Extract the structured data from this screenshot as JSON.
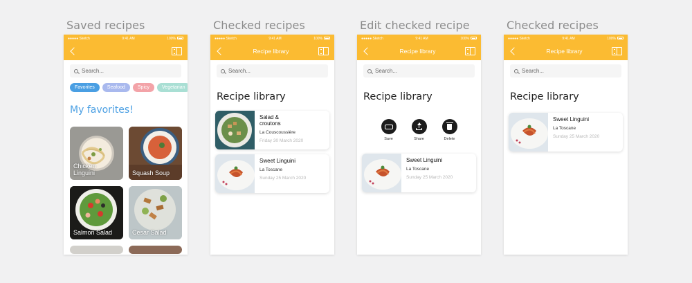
{
  "screens": [
    {
      "title": "Saved recipes",
      "search_placeholder": "Search...",
      "tags": [
        {
          "label": "Favorites",
          "color": "#4a9fe3"
        },
        {
          "label": "Seafood",
          "color": "#a9b9ee"
        },
        {
          "label": "Spicy",
          "color": "#f3a3a8"
        },
        {
          "label": "Vegetarian",
          "color": "#a9dfd4"
        }
      ],
      "favorites_heading": "My favorites!",
      "favorites": [
        {
          "label": "Chicken Linguini"
        },
        {
          "label": "Squash Soup"
        },
        {
          "label": "Salmon Salad"
        },
        {
          "label": "Cesar Salad"
        }
      ]
    },
    {
      "title": "Checked recipes",
      "nav_title": "Recipe library",
      "search_placeholder": "Search...",
      "heading": "Recipe library",
      "recipes": [
        {
          "name": "Salad & croutons",
          "place": "La Couscoussière",
          "date": "Friday 30 March 2020"
        },
        {
          "name": "Sweet Linguini",
          "place": "La Toscane",
          "date": "Sunday 25 March 2020"
        }
      ]
    },
    {
      "title": "Edit checked recipe",
      "nav_title": "Recipe library",
      "search_placeholder": "Search...",
      "heading": "Recipe library",
      "actions": [
        {
          "label": "Save",
          "icon": "save-icon"
        },
        {
          "label": "Share",
          "icon": "share-icon"
        },
        {
          "label": "Delete",
          "icon": "trash-icon"
        }
      ],
      "recipes": [
        {
          "name": "Sweet Linguini",
          "place": "La Toscane",
          "date": "Sunday 25 March 2020"
        }
      ]
    },
    {
      "title": "Checked recipes",
      "nav_title": "Recipe library",
      "search_placeholder": "Search...",
      "heading": "Recipe library",
      "recipes": [
        {
          "name": "Sweet Linguini",
          "place": "La Toscane",
          "date": "Sunday 25 March 2020"
        }
      ]
    }
  ],
  "status_bar": {
    "carrier": "Sketch",
    "time": "9:41 AM",
    "battery": "100%"
  },
  "colors": {
    "accent": "#fbbb32",
    "favorites_blue": "#4a9fe3"
  }
}
